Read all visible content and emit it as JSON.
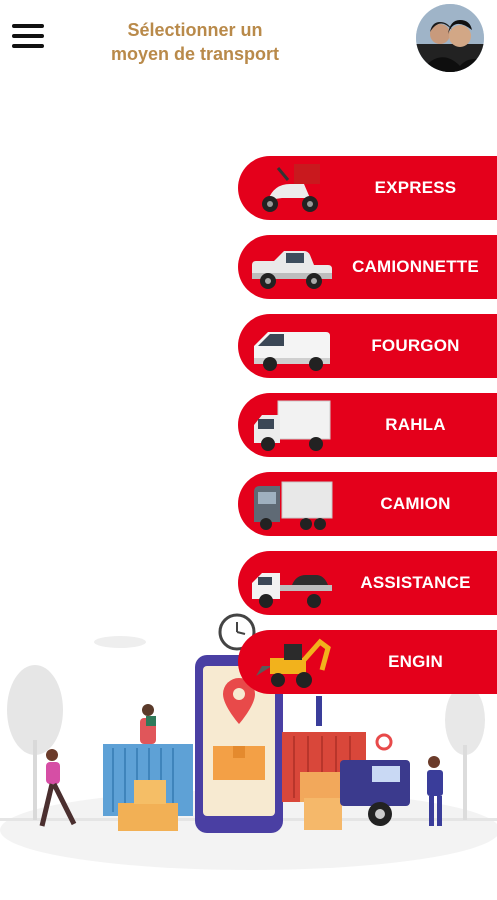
{
  "header": {
    "title_line1": "Sélectionner un",
    "title_line2": "moyen de transport"
  },
  "options": [
    {
      "label": "EXPRESS",
      "icon": "scooter-icon"
    },
    {
      "label": "CAMIONNETTE",
      "icon": "pickup-truck-icon"
    },
    {
      "label": "FOURGON",
      "icon": "van-icon"
    },
    {
      "label": "RAHLA",
      "icon": "box-truck-icon"
    },
    {
      "label": "CAMION",
      "icon": "semi-truck-icon"
    },
    {
      "label": "ASSISTANCE",
      "icon": "tow-truck-icon"
    },
    {
      "label": "ENGIN",
      "icon": "backhoe-icon"
    }
  ],
  "colors": {
    "accent": "#e4001b",
    "title": "#b98a4a"
  }
}
